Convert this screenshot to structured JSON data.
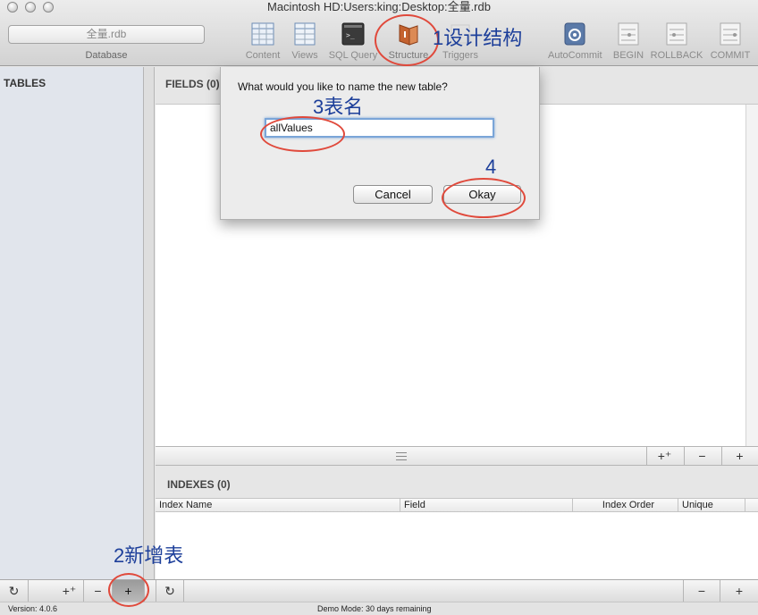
{
  "window": {
    "title": "Macintosh HD:Users:king:Desktop:全量.rdb"
  },
  "toolbar": {
    "database_name": "全量.rdb",
    "database_caption": "Database",
    "items": [
      {
        "label": "Content",
        "icon": "table-icon"
      },
      {
        "label": "Views",
        "icon": "views-icon"
      },
      {
        "label": "SQL Query",
        "icon": "terminal-icon"
      },
      {
        "label": "Structure",
        "icon": "structure-icon"
      },
      {
        "label": "Triggers",
        "icon": "triggers-icon"
      },
      {
        "label": "AutoCommit",
        "icon": "autocommit-icon"
      },
      {
        "label": "BEGIN",
        "icon": "begin-icon"
      },
      {
        "label": "ROLLBACK",
        "icon": "rollback-icon"
      },
      {
        "label": "COMMIT",
        "icon": "commit-icon"
      }
    ]
  },
  "sidebar": {
    "title": "TABLES"
  },
  "fields": {
    "title": "FIELDS (0)",
    "add_label": "+",
    "remove_label": "−",
    "add_multiple_label": "+⁺"
  },
  "indexes": {
    "title": "INDEXES (0)",
    "columns": [
      "Index Name",
      "Field",
      "Index Order",
      "Unique"
    ]
  },
  "bottom": {
    "refresh_label": "↻",
    "add_multiple_label": "+⁺",
    "remove_label": "−",
    "add_label": "+",
    "refresh2_label": "↻",
    "idx_remove_label": "−",
    "idx_add_label": "+"
  },
  "status": {
    "version": "Version: 4.0.6",
    "demo": "Demo Mode: 30 days remaining"
  },
  "dialog": {
    "message": "What would you like to name the new table?",
    "input_value": "allValues",
    "cancel_label": "Cancel",
    "okay_label": "Okay"
  },
  "annotations": {
    "step1": "1设计结构",
    "step2": "2新增表",
    "step3": "3表名",
    "step4": "4",
    "ring_color": "#e0493b",
    "text_color": "#1d3f9a"
  }
}
